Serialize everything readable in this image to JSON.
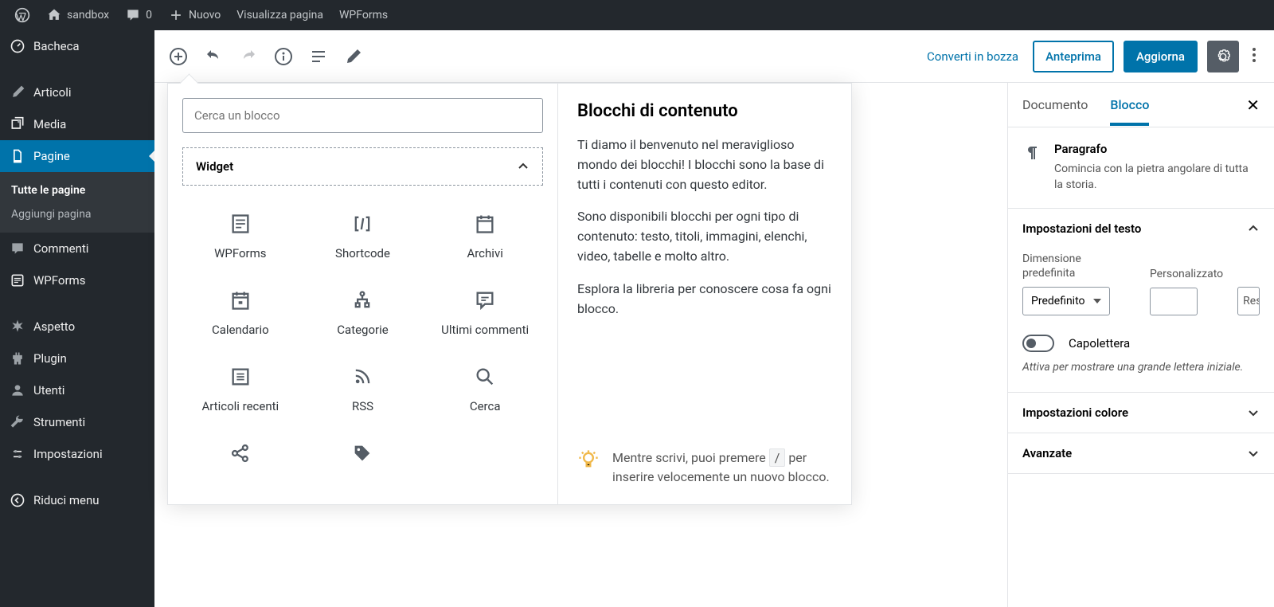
{
  "adminbar": {
    "site": "sandbox",
    "comments": "0",
    "new": "Nuovo",
    "view_page": "Visualizza pagina",
    "wpforms": "WPForms"
  },
  "sidebar": {
    "dashboard": "Bacheca",
    "posts": "Articoli",
    "media": "Media",
    "pages": "Pagine",
    "pages_sub_all": "Tutte le pagine",
    "pages_sub_add": "Aggiungi pagina",
    "comments": "Commenti",
    "wpforms": "WPForms",
    "appearance": "Aspetto",
    "plugins": "Plugin",
    "users": "Utenti",
    "tools": "Strumenti",
    "settings": "Impostazioni",
    "collapse": "Riduci menu"
  },
  "editor": {
    "switch_draft": "Converti in bozza",
    "preview": "Anteprima",
    "update": "Aggiorna"
  },
  "inserter": {
    "search_placeholder": "Cerca un blocco",
    "category": "Widget",
    "blocks": {
      "wpforms": "WPForms",
      "shortcode": "Shortcode",
      "archives": "Archivi",
      "calendar": "Calendario",
      "categories": "Categorie",
      "latest_comments": "Ultimi commenti",
      "latest_posts": "Articoli recenti",
      "rss": "RSS",
      "search": "Cerca"
    },
    "desc_title": "Blocchi di contenuto",
    "p1": "Ti diamo il benvenuto nel meraviglioso mondo dei blocchi! I blocchi sono la base di tutti i contenuti con questo editor.",
    "p2": "Sono disponibili blocchi per ogni tipo di contenuto: testo, titoli, immagini, elenchi, video, tabelle e molto altro.",
    "p3": "Esplora la libreria per conoscere cosa fa ogni blocco.",
    "tip_pre": "Mentre scrivi, puoi premere ",
    "tip_key": "/",
    "tip_post": " per inserire velocemente un nuovo blocco."
  },
  "rpanel": {
    "tab_doc": "Documento",
    "tab_block": "Blocco",
    "block_title": "Paragrafo",
    "block_desc": "Comincia con la pietra angolare di tutta la storia.",
    "text_settings": "Impostazioni del testo",
    "preset_label": "Dimensione predefinita",
    "preset_value": "Predefinito",
    "custom_label": "Personalizzato",
    "reset": "Reset",
    "dropcap": "Capolettera",
    "dropcap_help": "Attiva per mostrare una grande lettera iniziale.",
    "color_settings": "Impostazioni colore",
    "advanced": "Avanzate"
  }
}
